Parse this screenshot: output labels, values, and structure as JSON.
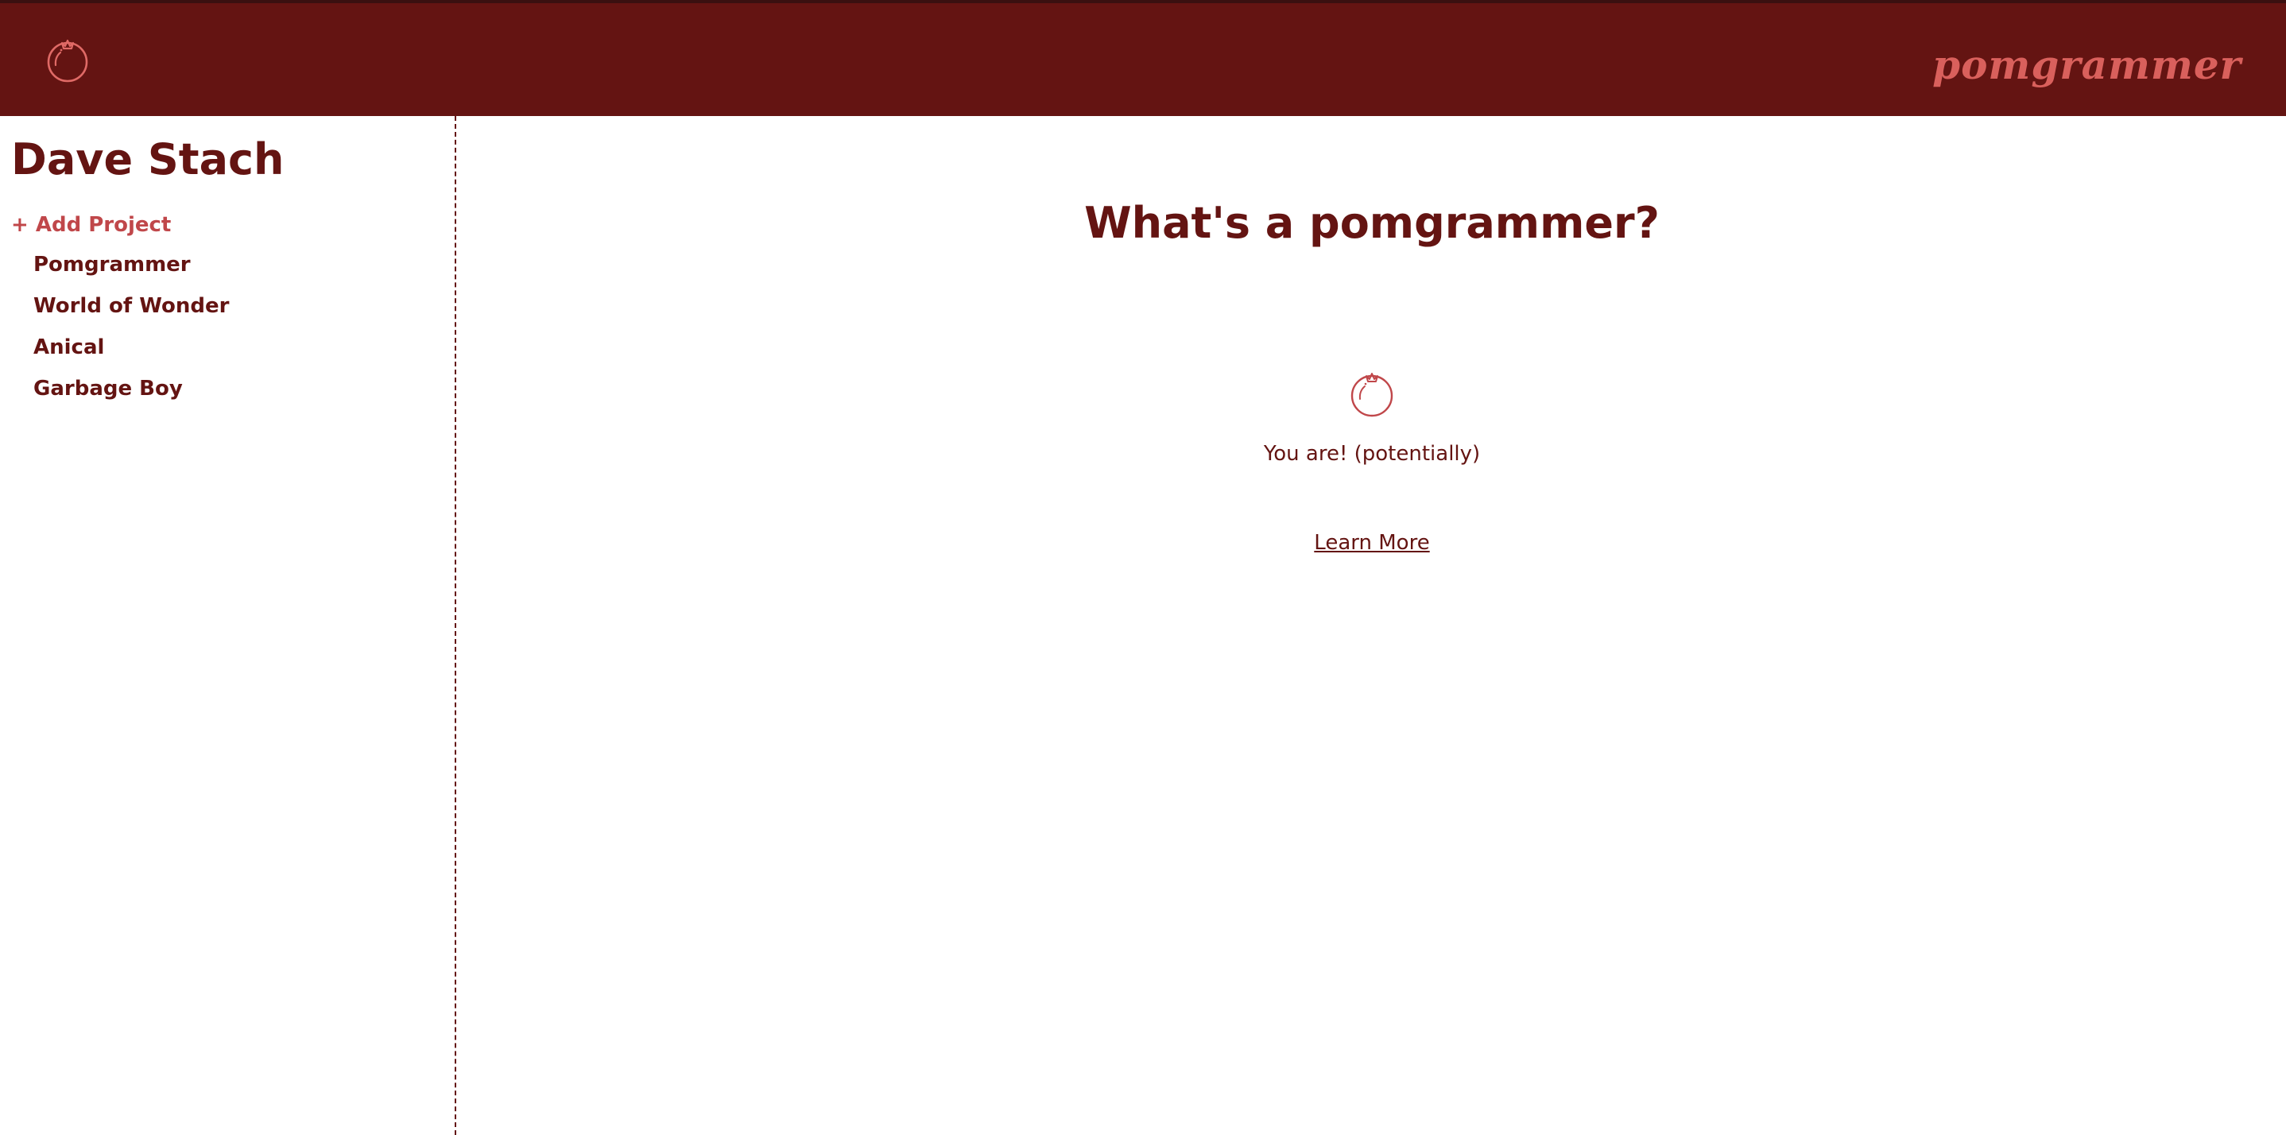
{
  "header": {
    "brand": "pomgrammer",
    "logo_icon": "pomegranate-icon"
  },
  "sidebar": {
    "user_name": "Dave Stach",
    "add_project_label": "+ Add Project",
    "projects": [
      {
        "label": "Pomgrammer"
      },
      {
        "label": "World of Wonder"
      },
      {
        "label": "Anical"
      },
      {
        "label": "Garbage Boy"
      }
    ]
  },
  "main": {
    "headline": "What's a pomgrammer?",
    "icon": "pomegranate-icon",
    "tagline": "You are! (potentially)",
    "learn_more_label": "Learn More"
  },
  "colors": {
    "header_bg": "#641412",
    "primary_text": "#641412",
    "accent": "#d9605c",
    "add_project": "#c0474a",
    "icon_stroke": "#c0474a"
  }
}
